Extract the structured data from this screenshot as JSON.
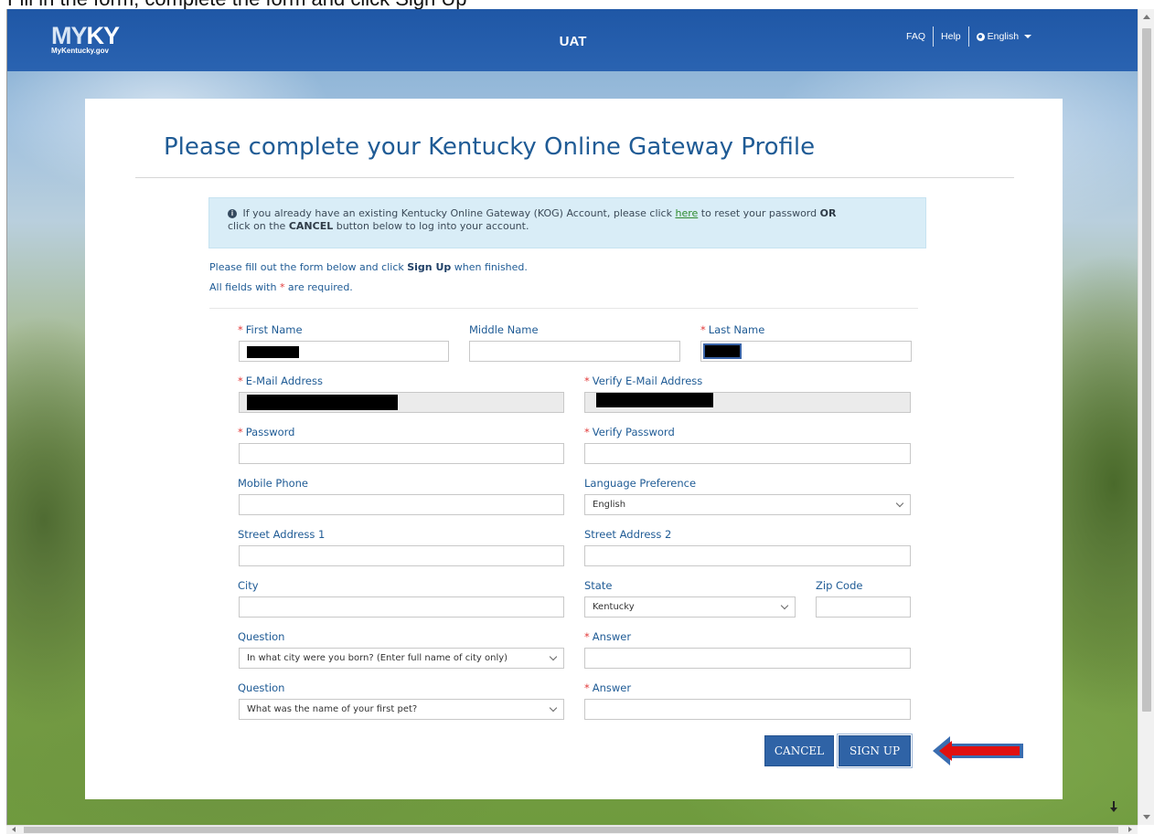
{
  "top_caption": "Fill in the form, complete the form and click Sign Up",
  "header": {
    "logo_mark_my": "MY",
    "logo_mark_ky": "KY",
    "logo_sub": "MyKentucky.gov",
    "env_label": "UAT",
    "links": {
      "faq": "FAQ",
      "help": "Help",
      "language": "English"
    }
  },
  "page": {
    "title": "Please complete your Kentucky Online Gateway Profile",
    "info": {
      "text_before_link": "If you already have an existing Kentucky Online Gateway (KOG) Account, please click ",
      "link": "here",
      "text_after_link": " to reset your password ",
      "or": "OR",
      "line2_before": "click on the ",
      "cancel_word": "CANCEL",
      "line2_after": " button below to log into your account."
    },
    "instruction_before": "Please fill out the form below and click ",
    "instruction_bold": "Sign Up",
    "instruction_after": " when finished.",
    "required_before": "All fields with ",
    "required_star": "*",
    "required_after": " are required."
  },
  "form": {
    "first_name_label": "First Name",
    "middle_name_label": "Middle Name",
    "last_name_label": "Last Name",
    "email_label": "E-Mail Address",
    "verify_email_label": "Verify E-Mail Address",
    "password_label": "Password",
    "verify_password_label": "Verify Password",
    "mobile_phone_label": "Mobile Phone",
    "language_label": "Language Preference",
    "language_value": "English",
    "street1_label": "Street Address 1",
    "street2_label": "Street Address 2",
    "city_label": "City",
    "state_label": "State",
    "state_value": "Kentucky",
    "zip_label": "Zip Code",
    "question1_label": "Question",
    "question1_value": "In what city were you born? (Enter full name of city only)",
    "answer1_label": "Answer",
    "question2_label": "Question",
    "question2_value": "What was the name of your first pet?",
    "answer2_label": "Answer"
  },
  "buttons": {
    "cancel": "CANCEL",
    "signup": "SIGN UP"
  },
  "colors": {
    "brand_blue": "#2a63b1",
    "label_blue": "#1f5b95",
    "required_red": "#e23b3b",
    "annotation_arrow": "#e01010"
  }
}
